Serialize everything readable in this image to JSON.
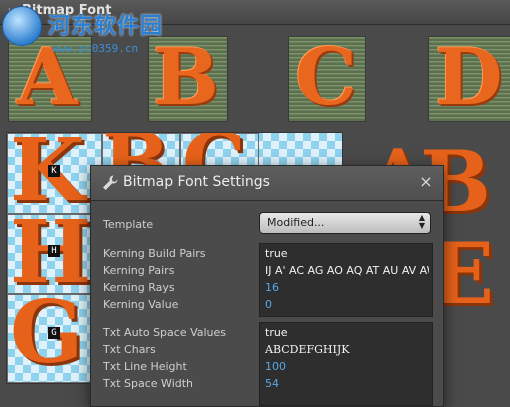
{
  "app": {
    "panel_title": "Bitmap Font"
  },
  "watermark": {
    "name": "河东软件园",
    "url": "www.pc0359.cn"
  },
  "preview_glyphs": [
    "A",
    "B",
    "C",
    "D"
  ],
  "atlas": {
    "labels": [
      "K",
      "H",
      "G"
    ],
    "glyphs": [
      "K",
      "H",
      "G",
      "B",
      "C"
    ]
  },
  "backdrop_letters": [
    "A",
    "B",
    "E"
  ],
  "dialog": {
    "title": "Bitmap Font Settings",
    "close_glyph": "×",
    "template_label": "Template",
    "template_value": "Modified...",
    "kerning": [
      {
        "label": "Kerning Build Pairs",
        "value": "true",
        "style": "white"
      },
      {
        "label": "Kerning Pairs",
        "value": "IJ A' AC AG AO AQ AT AU AV AW A",
        "style": "white"
      },
      {
        "label": "Kerning Rays",
        "value": "16",
        "style": "blue"
      },
      {
        "label": "Kerning Value",
        "value": "0",
        "style": "blue"
      }
    ],
    "txt": [
      {
        "label": "Txt Auto Space Values",
        "value": "true",
        "style": "white"
      },
      {
        "label": "Txt Chars",
        "value": "ABCDEFGHIJK",
        "style": "serif"
      },
      {
        "label": "Txt Line Height",
        "value": "100",
        "style": "blue"
      },
      {
        "label": "Txt Space Width",
        "value": "54",
        "style": "blue"
      }
    ]
  },
  "colors": {
    "accent_orange": "#e8661e",
    "value_blue": "#57a8e8",
    "panel_bg": "#4a4a4a"
  }
}
